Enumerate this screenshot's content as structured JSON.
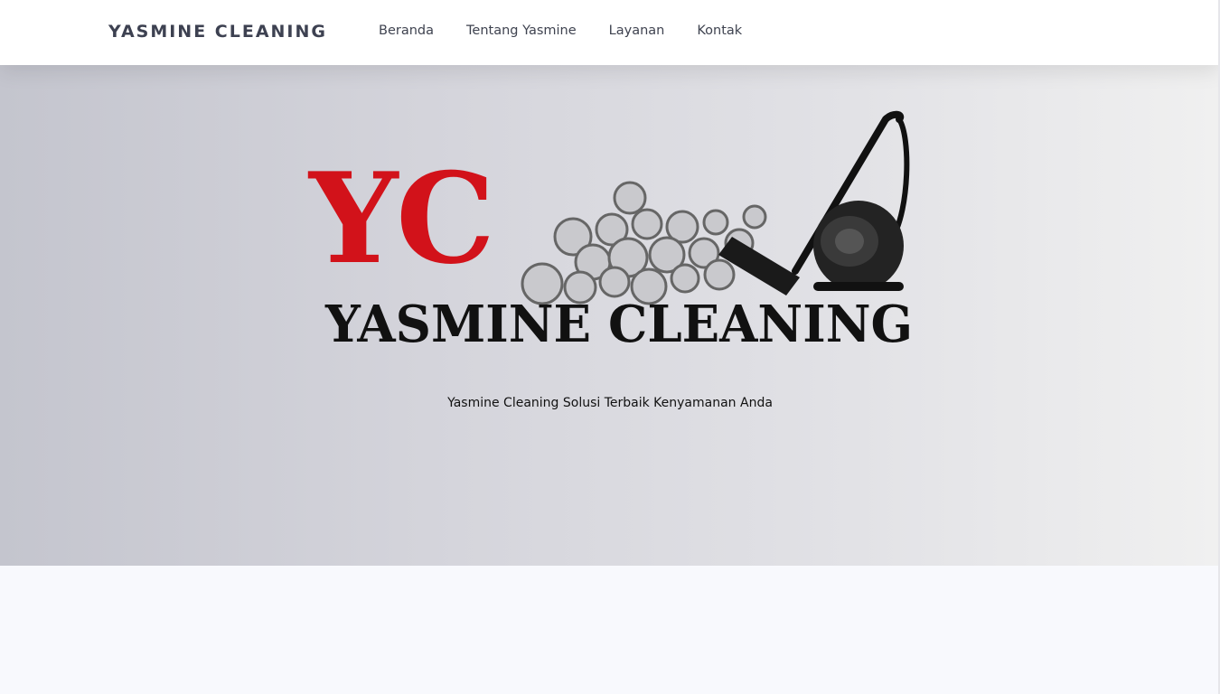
{
  "navbar": {
    "brand": "YASMINE CLEANING",
    "links": [
      "Beranda",
      "Tentang Yasmine",
      "Layanan",
      "Kontak"
    ]
  },
  "hero": {
    "logo": {
      "monogram": "YC",
      "wordmark": "YASMINE CLEANING",
      "monogram_color": "#d2121a",
      "wordmark_color": "#111111",
      "decoration": [
        "soap-bubbles",
        "vacuum-cleaner"
      ]
    },
    "tagline": "Yasmine Cleaning Solusi Terbaik Kenyamanan Anda"
  },
  "colors": {
    "nav_bg": "#ffffff",
    "nav_text": "#3f4350",
    "page_bg": "#f8f9fd"
  }
}
